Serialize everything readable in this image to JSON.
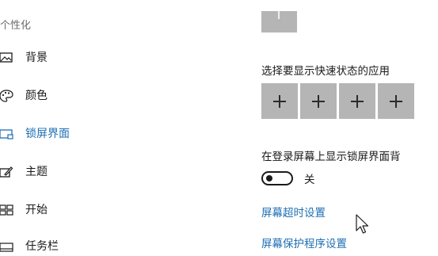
{
  "sidebar": {
    "section_title": "个性化",
    "items": [
      {
        "label": "背景",
        "icon": "picture-icon"
      },
      {
        "label": "颜色",
        "icon": "palette-icon"
      },
      {
        "label": "锁屏界面",
        "icon": "lock-screen-icon",
        "selected": true
      },
      {
        "label": "主题",
        "icon": "theme-brush-icon"
      },
      {
        "label": "开始",
        "icon": "start-layout-icon"
      },
      {
        "label": "任务栏",
        "icon": "taskbar-icon"
      }
    ]
  },
  "main": {
    "quick_status_heading": "选择要显示快速状态的应用",
    "quick_status_tiles": [
      "+",
      "+",
      "+",
      "+"
    ],
    "signin_bg_heading": "在登录屏幕上显示锁屏界面背",
    "signin_bg_toggle": {
      "state_label": "关",
      "on": false
    },
    "screen_timeout_link": "屏幕超时设置",
    "screensaver_link": "屏幕保护程序设置"
  },
  "colors": {
    "accent": "#1e6fb3",
    "tile": "#b5b5b5"
  }
}
